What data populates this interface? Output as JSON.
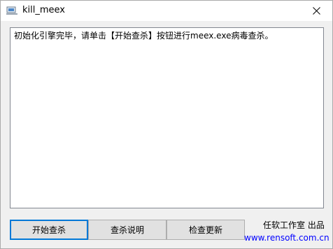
{
  "window": {
    "title": "kill_meex",
    "app_icon": "computer-icon",
    "close_icon": "close-icon"
  },
  "log": {
    "text": "初始化引擎完毕，请单击【开始查杀】按钮进行meex.exe病毒查杀。"
  },
  "buttons": {
    "start_scan": "开始查杀",
    "scan_help": "查杀说明",
    "check_update": "检查更新"
  },
  "footer": {
    "credit": "任软工作室 出品",
    "url": "www.rensoft.com.cn"
  },
  "colors": {
    "accent": "#0078d7",
    "link": "#0000ff"
  }
}
